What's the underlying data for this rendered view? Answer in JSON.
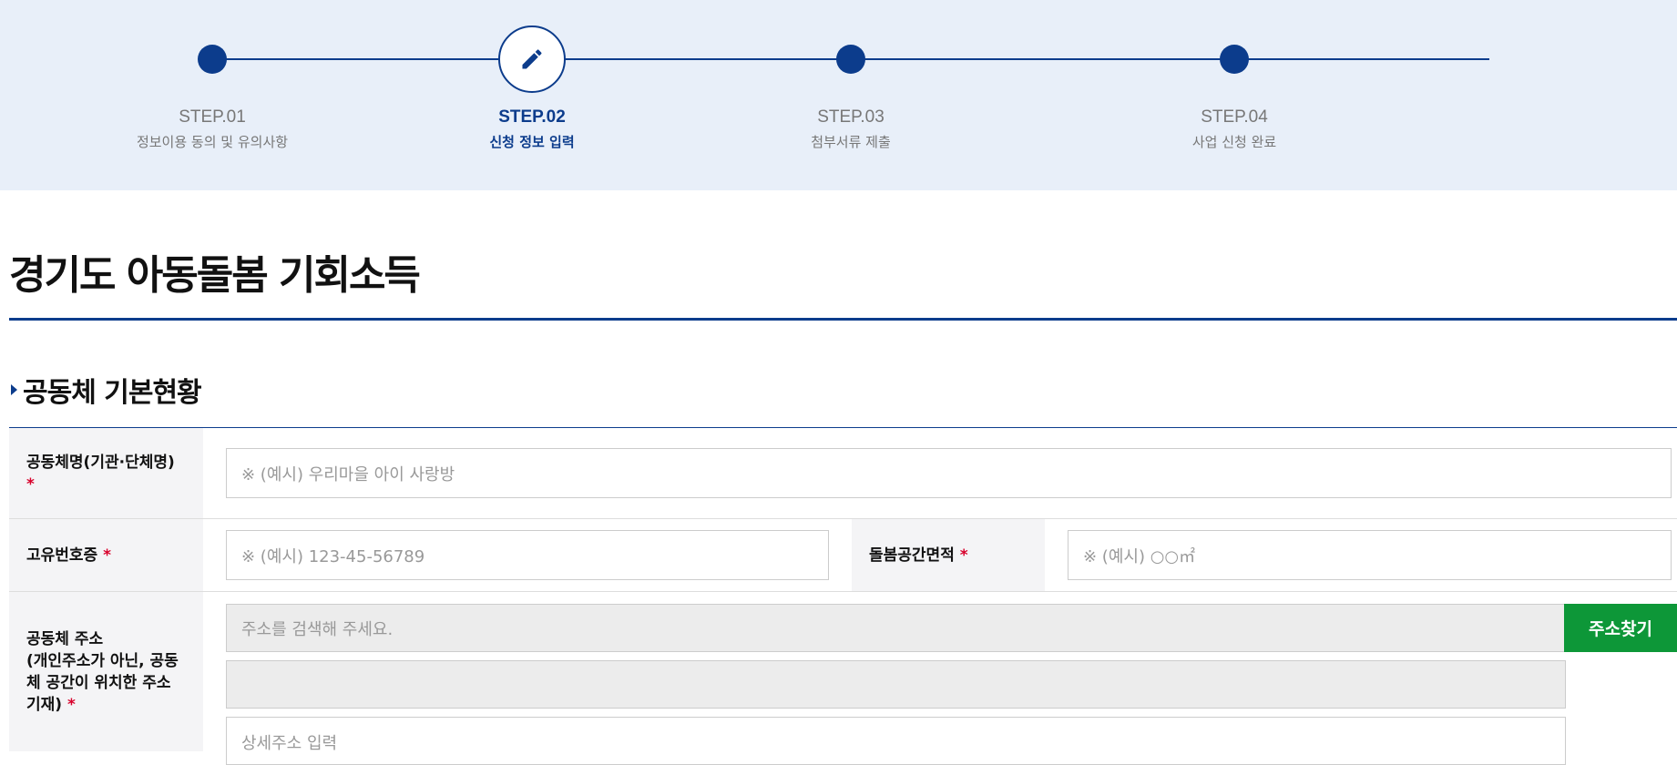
{
  "steps": [
    {
      "num": "STEP.01",
      "desc": "정보이용 동의 및 유의사항",
      "state": "done"
    },
    {
      "num": "STEP.02",
      "desc": "신청 정보 입력",
      "state": "current",
      "icon": "pencil-icon"
    },
    {
      "num": "STEP.03",
      "desc": "첨부서류 제출",
      "state": "pending"
    },
    {
      "num": "STEP.04",
      "desc": "사업 신청 완료",
      "state": "pending"
    }
  ],
  "page_title": "경기도 아동돌봄 기회소득",
  "section_title": "공동체 기본현황",
  "form": {
    "org_name": {
      "label": "공동체명(기관·단체명)",
      "required": "*",
      "placeholder": "※ (예시) 우리마을 아이 사랑방"
    },
    "reg_number": {
      "label": "고유번호증",
      "required": "*",
      "placeholder": "※ (예시) 123-45-56789"
    },
    "care_area": {
      "label": "돌봄공간면적",
      "required": "*",
      "placeholder": "※ (예시) ○○㎡"
    },
    "address": {
      "label": "공동체 주소 (개인주소가 아닌, 공동체 공간이 위치한 주소 기재)",
      "label_lines": [
        "공동체 주소",
        "(개인주소가 아닌, 공동",
        "체 공간이 위치한 주소",
        "기재)"
      ],
      "required": "*",
      "search_placeholder": "주소를 검색해 주세요.",
      "search_button": "주소찾기",
      "address2_value": "",
      "detail_placeholder": "상세주소 입력"
    }
  },
  "colors": {
    "primary": "#0c3c8c",
    "stepper_bg": "#e8eff9",
    "required": "#d8002b",
    "search_button": "#0d9738"
  }
}
